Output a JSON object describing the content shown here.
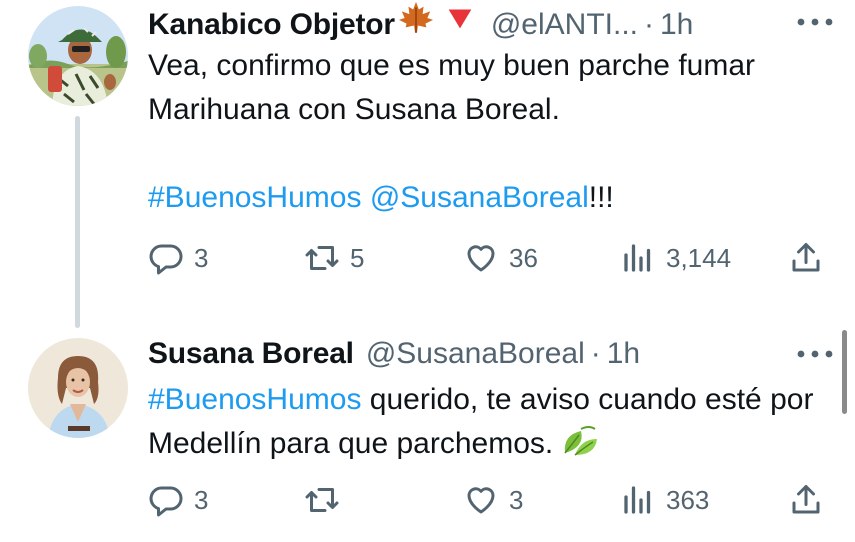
{
  "tweets": [
    {
      "author_name": "Kanabico Objetor",
      "badges": [
        "maple-leaf",
        "red-down-triangle"
      ],
      "handle": "@elANTI...",
      "separator": "·",
      "time": "1h",
      "text_line_1": "Vea, confirmo que es muy buen parche fumar Marihuana con Susana Boreal.",
      "hashtag": "#BuenosHumos",
      "mention": "@SusanaBoreal",
      "text_suffix": "!!!",
      "replies": "3",
      "retweets": "5",
      "likes": "36",
      "views": "3,144"
    },
    {
      "author_name": "Susana Boreal",
      "handle": "@SusanaBoreal",
      "separator": "·",
      "time": "1h",
      "hashtag": "#BuenosHumos",
      "text": " querido, te aviso cuando esté por Medellín para que parchemos.",
      "emoji": "leaves",
      "replies": "3",
      "retweets": "",
      "likes": "3",
      "views": "363"
    }
  ],
  "colors": {
    "text": "#0f1419",
    "secondary": "#536471",
    "link": "#1d9bf0",
    "thread_line": "#cfd9de"
  }
}
